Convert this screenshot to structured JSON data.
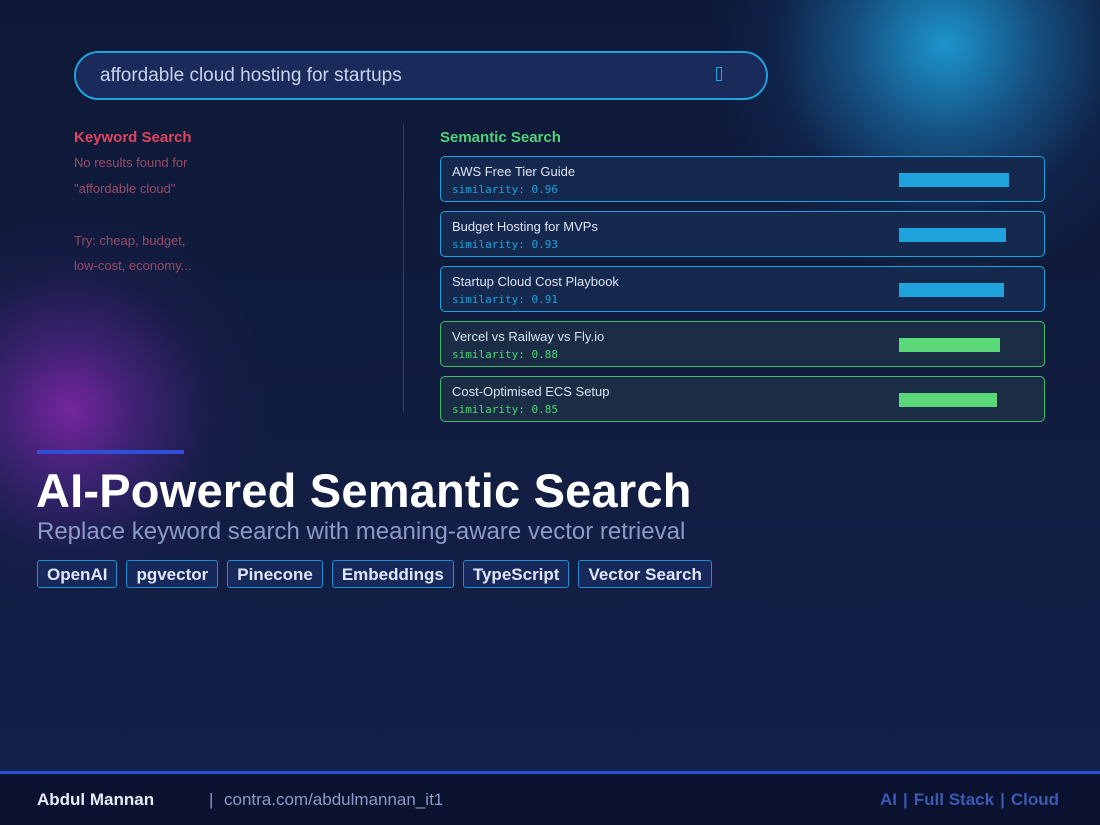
{
  "search": {
    "query": "affordable cloud hosting for startups"
  },
  "keyword": {
    "title": "Keyword Search",
    "lines": [
      "No results found for",
      "\"affordable cloud\"",
      "Try: cheap, budget,",
      "low-cost, economy..."
    ]
  },
  "semantic": {
    "title": "Semantic Search",
    "results": [
      {
        "name": "AWS Free Tier Guide",
        "score_text": "similarity: 0.96",
        "similarity": 0.96,
        "style": "blue"
      },
      {
        "name": "Budget Hosting for MVPs",
        "score_text": "similarity: 0.93",
        "similarity": 0.93,
        "style": "blue"
      },
      {
        "name": "Startup Cloud Cost Playbook",
        "score_text": "similarity: 0.91",
        "similarity": 0.91,
        "style": "blue"
      },
      {
        "name": "Vercel vs Railway vs Fly.io",
        "score_text": "similarity: 0.88",
        "similarity": 0.88,
        "style": "green"
      },
      {
        "name": "Cost-Optimised ECS Setup",
        "score_text": "similarity: 0.85",
        "similarity": 0.85,
        "style": "green"
      }
    ]
  },
  "hero": {
    "title": "AI-Powered Semantic Search",
    "subtitle": "Replace keyword search with meaning-aware vector retrieval",
    "tags": [
      "OpenAI",
      "pgvector",
      "Pinecone",
      "Embeddings",
      "TypeScript",
      "Vector Search"
    ]
  },
  "footer": {
    "name": "Abdul Mannan",
    "separator": "|",
    "link": "contra.com/abdulmannan_it1",
    "right": [
      "AI",
      "Full Stack",
      "Cloud"
    ],
    "right_separator": "|"
  },
  "colors": {
    "accent_blue": "#1fa3dc",
    "accent_green": "#4fd37a",
    "keyword_red": "#e0455f"
  }
}
